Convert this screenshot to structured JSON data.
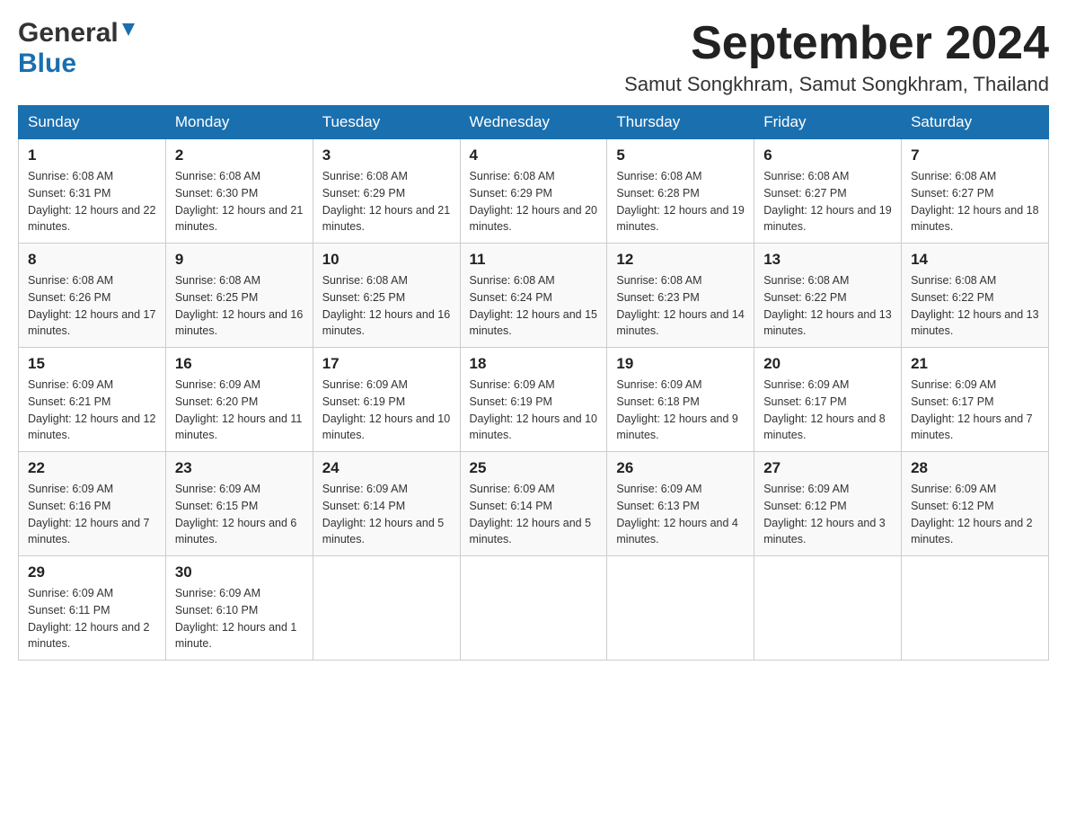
{
  "header": {
    "logo_general": "General",
    "logo_blue": "Blue",
    "month_title": "September 2024",
    "location": "Samut Songkhram, Samut Songkhram, Thailand"
  },
  "days_of_week": [
    "Sunday",
    "Monday",
    "Tuesday",
    "Wednesday",
    "Thursday",
    "Friday",
    "Saturday"
  ],
  "weeks": [
    [
      {
        "day": "1",
        "sunrise": "6:08 AM",
        "sunset": "6:31 PM",
        "daylight": "12 hours and 22 minutes."
      },
      {
        "day": "2",
        "sunrise": "6:08 AM",
        "sunset": "6:30 PM",
        "daylight": "12 hours and 21 minutes."
      },
      {
        "day": "3",
        "sunrise": "6:08 AM",
        "sunset": "6:29 PM",
        "daylight": "12 hours and 21 minutes."
      },
      {
        "day": "4",
        "sunrise": "6:08 AM",
        "sunset": "6:29 PM",
        "daylight": "12 hours and 20 minutes."
      },
      {
        "day": "5",
        "sunrise": "6:08 AM",
        "sunset": "6:28 PM",
        "daylight": "12 hours and 19 minutes."
      },
      {
        "day": "6",
        "sunrise": "6:08 AM",
        "sunset": "6:27 PM",
        "daylight": "12 hours and 19 minutes."
      },
      {
        "day": "7",
        "sunrise": "6:08 AM",
        "sunset": "6:27 PM",
        "daylight": "12 hours and 18 minutes."
      }
    ],
    [
      {
        "day": "8",
        "sunrise": "6:08 AM",
        "sunset": "6:26 PM",
        "daylight": "12 hours and 17 minutes."
      },
      {
        "day": "9",
        "sunrise": "6:08 AM",
        "sunset": "6:25 PM",
        "daylight": "12 hours and 16 minutes."
      },
      {
        "day": "10",
        "sunrise": "6:08 AM",
        "sunset": "6:25 PM",
        "daylight": "12 hours and 16 minutes."
      },
      {
        "day": "11",
        "sunrise": "6:08 AM",
        "sunset": "6:24 PM",
        "daylight": "12 hours and 15 minutes."
      },
      {
        "day": "12",
        "sunrise": "6:08 AM",
        "sunset": "6:23 PM",
        "daylight": "12 hours and 14 minutes."
      },
      {
        "day": "13",
        "sunrise": "6:08 AM",
        "sunset": "6:22 PM",
        "daylight": "12 hours and 13 minutes."
      },
      {
        "day": "14",
        "sunrise": "6:08 AM",
        "sunset": "6:22 PM",
        "daylight": "12 hours and 13 minutes."
      }
    ],
    [
      {
        "day": "15",
        "sunrise": "6:09 AM",
        "sunset": "6:21 PM",
        "daylight": "12 hours and 12 minutes."
      },
      {
        "day": "16",
        "sunrise": "6:09 AM",
        "sunset": "6:20 PM",
        "daylight": "12 hours and 11 minutes."
      },
      {
        "day": "17",
        "sunrise": "6:09 AM",
        "sunset": "6:19 PM",
        "daylight": "12 hours and 10 minutes."
      },
      {
        "day": "18",
        "sunrise": "6:09 AM",
        "sunset": "6:19 PM",
        "daylight": "12 hours and 10 minutes."
      },
      {
        "day": "19",
        "sunrise": "6:09 AM",
        "sunset": "6:18 PM",
        "daylight": "12 hours and 9 minutes."
      },
      {
        "day": "20",
        "sunrise": "6:09 AM",
        "sunset": "6:17 PM",
        "daylight": "12 hours and 8 minutes."
      },
      {
        "day": "21",
        "sunrise": "6:09 AM",
        "sunset": "6:17 PM",
        "daylight": "12 hours and 7 minutes."
      }
    ],
    [
      {
        "day": "22",
        "sunrise": "6:09 AM",
        "sunset": "6:16 PM",
        "daylight": "12 hours and 7 minutes."
      },
      {
        "day": "23",
        "sunrise": "6:09 AM",
        "sunset": "6:15 PM",
        "daylight": "12 hours and 6 minutes."
      },
      {
        "day": "24",
        "sunrise": "6:09 AM",
        "sunset": "6:14 PM",
        "daylight": "12 hours and 5 minutes."
      },
      {
        "day": "25",
        "sunrise": "6:09 AM",
        "sunset": "6:14 PM",
        "daylight": "12 hours and 5 minutes."
      },
      {
        "day": "26",
        "sunrise": "6:09 AM",
        "sunset": "6:13 PM",
        "daylight": "12 hours and 4 minutes."
      },
      {
        "day": "27",
        "sunrise": "6:09 AM",
        "sunset": "6:12 PM",
        "daylight": "12 hours and 3 minutes."
      },
      {
        "day": "28",
        "sunrise": "6:09 AM",
        "sunset": "6:12 PM",
        "daylight": "12 hours and 2 minutes."
      }
    ],
    [
      {
        "day": "29",
        "sunrise": "6:09 AM",
        "sunset": "6:11 PM",
        "daylight": "12 hours and 2 minutes."
      },
      {
        "day": "30",
        "sunrise": "6:09 AM",
        "sunset": "6:10 PM",
        "daylight": "12 hours and 1 minute."
      },
      null,
      null,
      null,
      null,
      null
    ]
  ]
}
